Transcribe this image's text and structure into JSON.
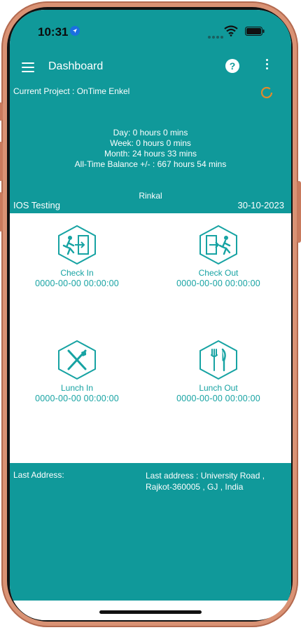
{
  "status_bar": {
    "time": "10:31"
  },
  "appbar": {
    "title": "Dashboard",
    "help_symbol": "?"
  },
  "info": {
    "current_project": "Current Project : OnTime Enkel",
    "day": "Day: 0 hours 0 mins",
    "week": "Week: 0 hours 0 mins",
    "month": "Month: 24 hours 33 mins",
    "balance": "All-Time Balance +/- : 667 hours 54 mins",
    "user": "Rinkal",
    "team": "IOS Testing",
    "date": "30-10-2023"
  },
  "tiles": {
    "check_in": {
      "label": "Check In",
      "timestamp": "0000-00-00 00:00:00",
      "icon": "check-in-icon"
    },
    "check_out": {
      "label": "Check Out",
      "timestamp": "0000-00-00 00:00:00",
      "icon": "check-out-icon"
    },
    "lunch_in": {
      "label": "Lunch In",
      "timestamp": "0000-00-00 00:00:00",
      "icon": "lunch-in-icon"
    },
    "lunch_out": {
      "label": "Lunch Out",
      "timestamp": "0000-00-00 00:00:00",
      "icon": "lunch-out-icon"
    }
  },
  "address": {
    "label": "Last Address:",
    "value": "Last address : University Road , Rajkot-360005 , GJ , India"
  },
  "colors": {
    "primary": "#10999a",
    "accent_text": "#17a3a3",
    "refresh": "#e08a2c"
  }
}
